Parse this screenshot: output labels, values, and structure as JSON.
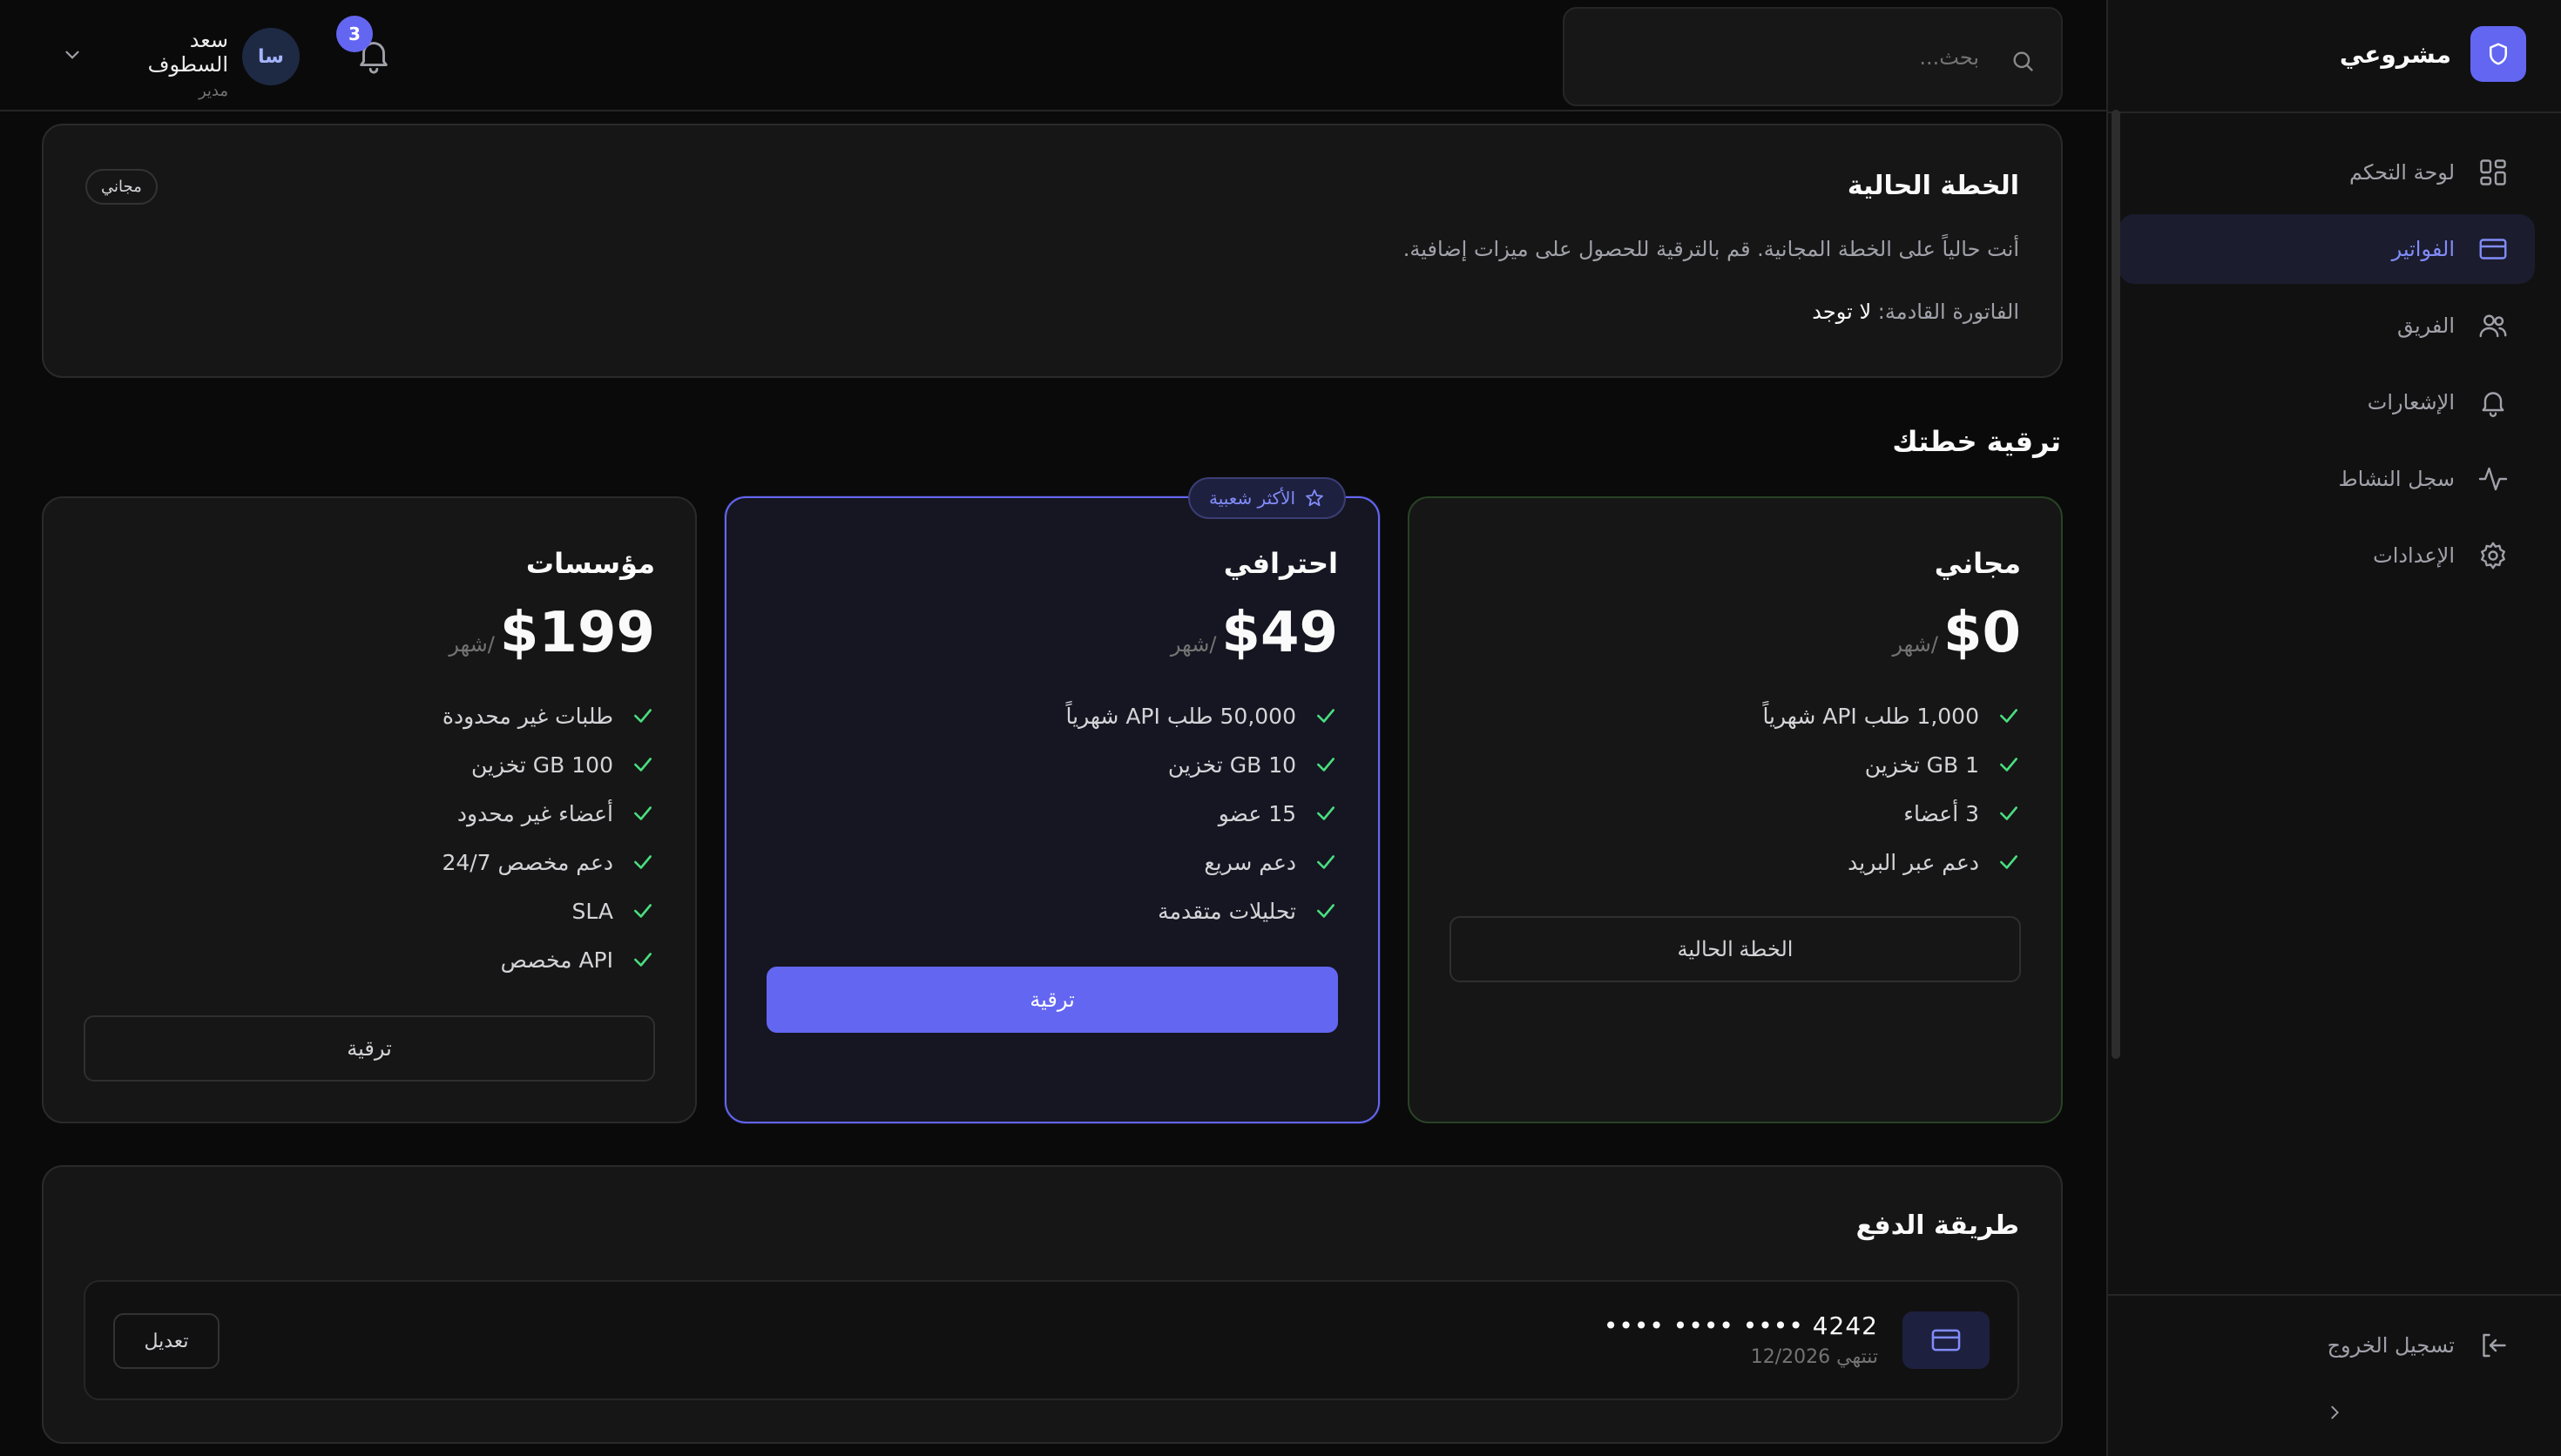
{
  "app": {
    "brand_name": "مشروعي"
  },
  "sidebar": {
    "items": [
      {
        "label": "لوحة التحكم",
        "icon": "dashboard-icon",
        "active": false
      },
      {
        "label": "الفواتير",
        "icon": "credit-card-icon",
        "active": true
      },
      {
        "label": "الفريق",
        "icon": "users-icon",
        "active": false
      },
      {
        "label": "الإشعارات",
        "icon": "bell-icon",
        "active": false
      },
      {
        "label": "سجل النشاط",
        "icon": "activity-icon",
        "active": false
      },
      {
        "label": "الإعدادات",
        "icon": "gear-icon",
        "active": false
      }
    ],
    "logout_label": "تسجيل الخروج"
  },
  "topbar": {
    "search_placeholder": "بحث...",
    "notification_count": "3",
    "user": {
      "initials": "سا",
      "name": "سعد السطوف",
      "role": "مدير"
    }
  },
  "current_plan": {
    "title": "الخطة الحالية",
    "badge": "مجاني",
    "description": "أنت حالياً على الخطة المجانية. قم بالترقية للحصول على ميزات إضافية.",
    "next_invoice_label": "الفاتورة القادمة:",
    "next_invoice_value": "لا توجد"
  },
  "upgrade": {
    "title": "ترقية خطتك",
    "plans": [
      {
        "name": "مجاني",
        "price": "$0",
        "period": "/شهر",
        "features": [
          "1,000 طلب API شهرياً",
          "1 GB تخزين",
          "3 أعضاء",
          "دعم عبر البريد"
        ],
        "button": "الخطة الحالية"
      },
      {
        "name": "احترافي",
        "price": "$49",
        "period": "/شهر",
        "badge": "الأكثر شعبية",
        "features": [
          "50,000 طلب API شهرياً",
          "10 GB تخزين",
          "15 عضو",
          "دعم سريع",
          "تحليلات متقدمة"
        ],
        "button": "ترقية"
      },
      {
        "name": "مؤسسات",
        "price": "$199",
        "period": "/شهر",
        "features": [
          "طلبات غير محدودة",
          "100 GB تخزين",
          "أعضاء غير محدود",
          "دعم مخصص 24/7",
          "SLA",
          "API مخصص"
        ],
        "button": "ترقية"
      }
    ]
  },
  "payment": {
    "title": "طريقة الدفع",
    "card_number": "•••• •••• •••• 4242",
    "expiry": "تنتهي 12/2026",
    "edit_label": "تعديل"
  },
  "colors": {
    "accent": "#6366f1",
    "check": "#4ade80",
    "background": "#0a0a0a",
    "card": "#161616"
  }
}
